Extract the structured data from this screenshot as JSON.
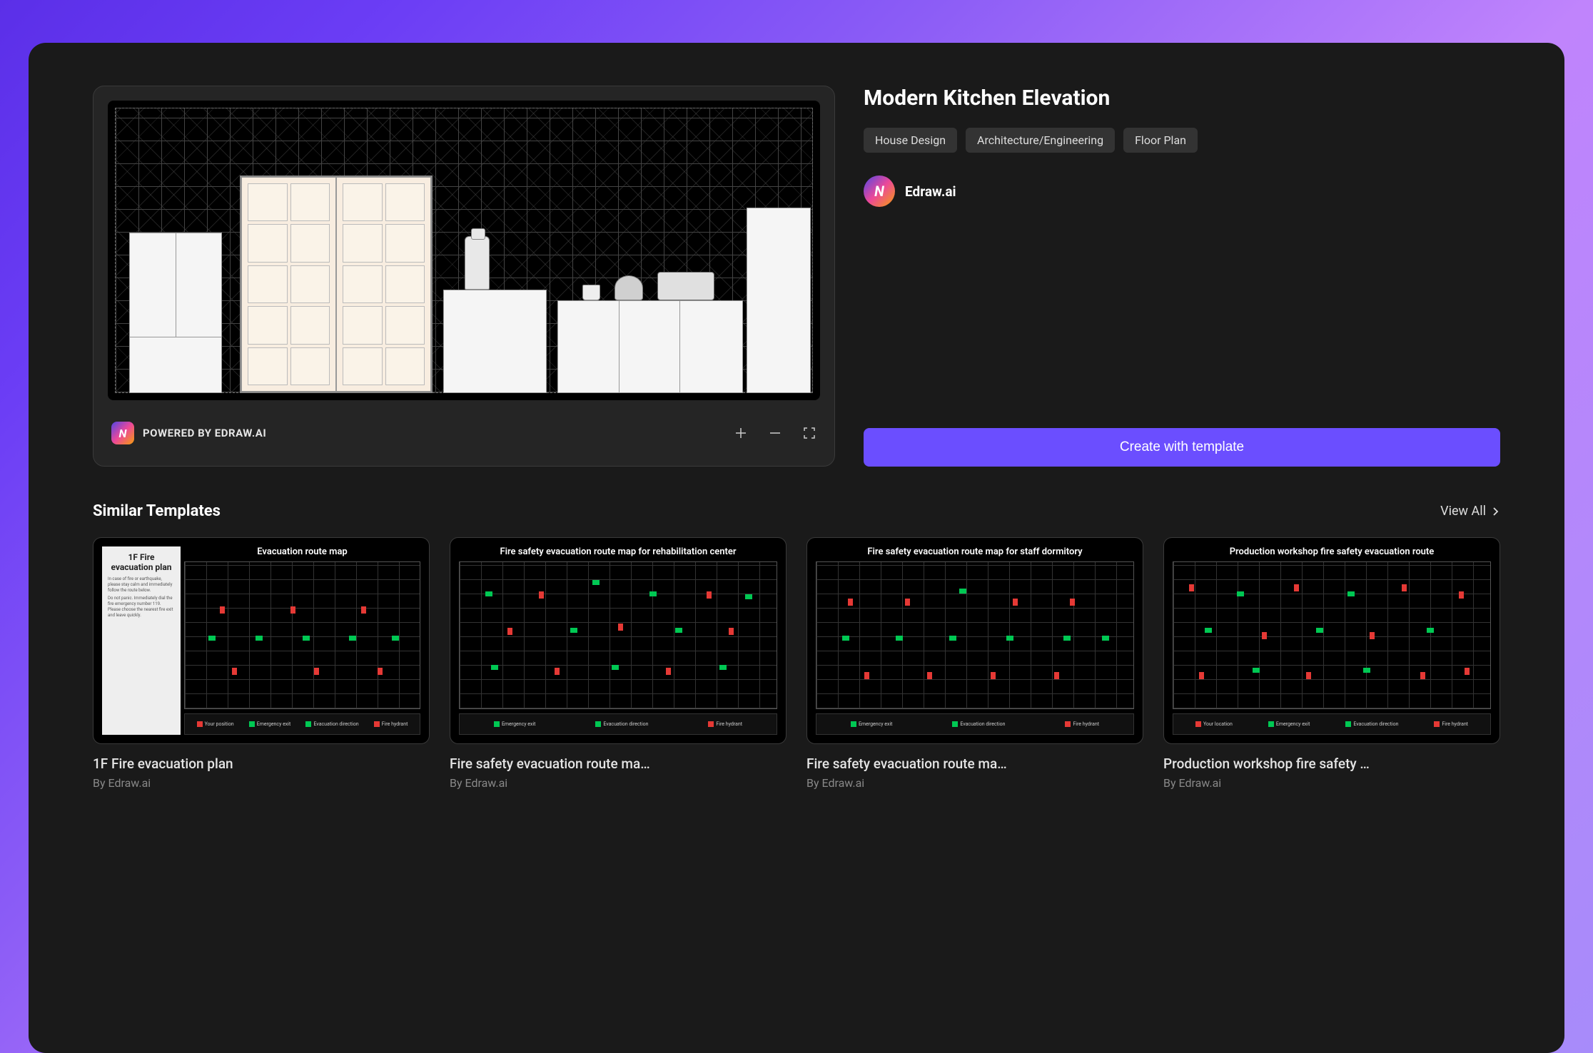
{
  "page_title": "Modern Kitchen Elevation",
  "tags": [
    "House Design",
    "Architecture/Engineering",
    "Floor Plan"
  ],
  "author": {
    "name": "Edraw.ai"
  },
  "powered_by": "POWERED BY EDRAW.AI",
  "create_button": "Create with template",
  "similar_section": {
    "title": "Similar Templates",
    "view_all": "View All"
  },
  "similar_templates": [
    {
      "name": "1F Fire evacuation plan",
      "author": "By Edraw.ai",
      "thumb_title": "Evacuation route map",
      "sidebar_title": "1F Fire evacuation plan",
      "legend": [
        "Your position",
        "Emergency exit",
        "Evacuation direction",
        "Fire hydrant"
      ]
    },
    {
      "name": "Fire safety evacuation route ma…",
      "author": "By Edraw.ai",
      "thumb_title": "Fire safety evacuation route map for rehabilitation center",
      "legend": [
        "Emergency exit",
        "Evacuation direction",
        "Fire hydrant"
      ]
    },
    {
      "name": "Fire safety evacuation route ma…",
      "author": "By Edraw.ai",
      "thumb_title": "Fire safety evacuation route map for staff dormitory",
      "legend": [
        "Emergency exit",
        "Evacuation direction",
        "Fire hydrant"
      ]
    },
    {
      "name": "Production workshop fire safety …",
      "author": "By Edraw.ai",
      "thumb_title": "Production workshop fire safety evacuation route",
      "legend": [
        "Your location",
        "Emergency exit",
        "Evacuation direction",
        "Fire hydrant"
      ]
    }
  ]
}
